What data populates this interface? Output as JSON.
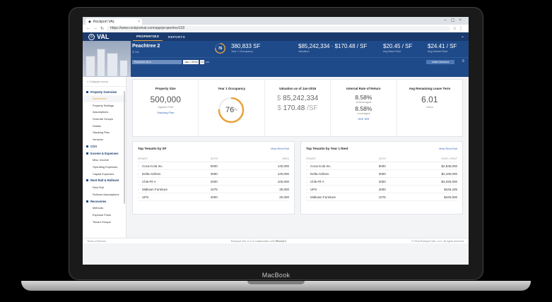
{
  "device": {
    "brand": "MacBook"
  },
  "browser": {
    "tab_title": "Rockport VAL",
    "url": "https://www.rockportval.com/app/properties/118"
  },
  "app": {
    "logo": "VAL",
    "nav": [
      "PROPERTIES",
      "REPORTS"
    ]
  },
  "property": {
    "name": "Peachtree 2",
    "location": "GA",
    "occupancy_pct": 76,
    "occupancy_ring_label": "76",
    "stats": [
      {
        "value": "380,833 SF",
        "label": "Year 1 Occupancy"
      },
      {
        "value": "$85,242,334 · $170.48 / SF",
        "label": "Valuation"
      },
      {
        "value": "$20.45 / SF",
        "label": "Avg Base Rent"
      },
      {
        "value": "$24.41 / SF",
        "label": "Avg Market Rent"
      }
    ],
    "toolbar": {
      "basis": "Baseline BLA",
      "date": "Jan / 2016",
      "years": "10",
      "years_label": "yrs",
      "versions_button": "Initial Versions"
    }
  },
  "sidebar": {
    "collapse_label": "Collapse menu",
    "groups": [
      {
        "label": "Property Overview",
        "items": [
          "Dashboard",
          "Property Settings",
          "Assumptions",
          "Override Groups",
          "Details",
          "Stacking Plan",
          "Versions"
        ]
      },
      {
        "label": "COA",
        "items": []
      },
      {
        "label": "Income & Expenses",
        "items": [
          "Misc. Income",
          "Operating Expenses",
          "Capital Expenses"
        ]
      },
      {
        "label": "Rent Roll & Rollover",
        "items": [
          "Rent Roll",
          "Rollover Assumptions"
        ]
      },
      {
        "label": "Recoveries",
        "items": [
          "Methods",
          "Expense Pools",
          "Tenant Groups"
        ]
      }
    ],
    "active_item": "Dashboard"
  },
  "kpis": {
    "property_size": {
      "title": "Property Size",
      "value": "500,000",
      "sub": "Square Feet",
      "link": "Stacking Plan"
    },
    "occupancy": {
      "title": "Year 1 Occupancy",
      "value": "76",
      "unit": "%"
    },
    "valuation": {
      "title": "Valuation as of Jan-2016",
      "total": "85,242,334",
      "per_sf": "170.48",
      "per_sf_unit": "/SF",
      "currency": "$"
    },
    "irr": {
      "title": "Internal Rate of Return",
      "unlev": "8.58%",
      "unlev_label": "Unleveraged",
      "lev": "8.58%",
      "lev_label": "Leveraged",
      "link": "SEE IRR"
    },
    "lease_term": {
      "title": "Avg Remaining Lease Term",
      "value": "6.01",
      "sub": "Years"
    }
  },
  "tables": {
    "by_sf": {
      "title": "Top Tenants by SF",
      "link": "View Rent Roll",
      "headers": [
        "TENANT",
        "SUITE",
        "AREA"
      ],
      "rows": [
        [
          "Coca-Cola Inc.",
          "5000",
          "140,000"
        ],
        [
          "Delta Airlines",
          "3000",
          "120,000"
        ],
        [
          "Chik-Fil-A",
          "2000",
          "100,000"
        ],
        [
          "Midtown Furniture",
          "1075",
          "30,000"
        ],
        [
          "UPS",
          "4000",
          "20,000"
        ]
      ]
    },
    "by_rent": {
      "title": "Top Tenants by Year 1 Rent",
      "link": "View Rent Roll",
      "headers": [
        "TENANT",
        "SUITE",
        "YEAR 1 RENT"
      ],
      "rows": [
        [
          "Coca-Cola Inc.",
          "5000",
          "$2,835,000"
        ],
        [
          "Delta Airlines",
          "3000",
          "$2,430,000"
        ],
        [
          "Chik-Fil-A",
          "2000",
          "$2,025,000"
        ],
        [
          "UPS",
          "4000",
          "$446,335"
        ],
        [
          "Midtown Furniture",
          "1075",
          "$420,000"
        ]
      ]
    }
  },
  "footer": {
    "left": "Terms of Service",
    "mid": "Rockport VAL LLC in collaboration with",
    "mid_brand": "Moody's",
    "right": "© 2018 Rockport VAL, LLC. All rights reserved."
  },
  "colors": {
    "navy": "#1a3a6e",
    "accent": "#e8a33a",
    "link": "#3b68b3"
  }
}
